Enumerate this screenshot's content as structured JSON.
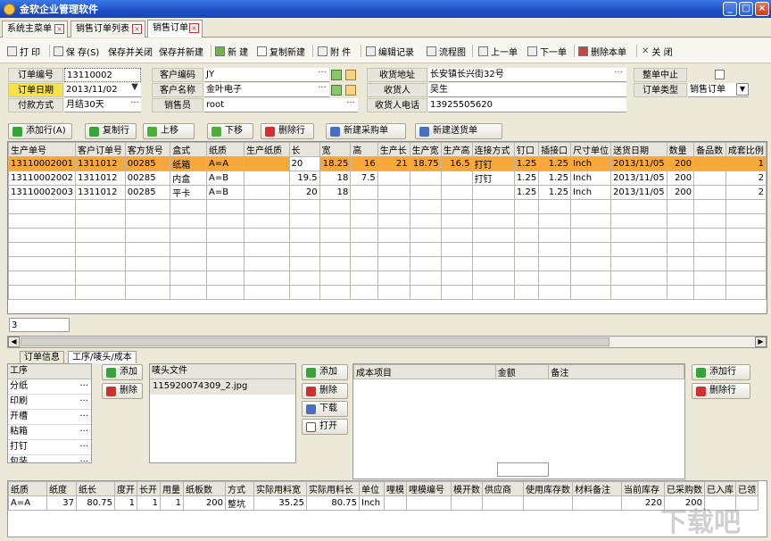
{
  "app": {
    "title": "金软企业管理软件",
    "icon": "app-icon"
  },
  "tabs": [
    {
      "label": "系统主菜单"
    },
    {
      "label": "销售订单列表"
    },
    {
      "label": "销售订单"
    }
  ],
  "toolbar": {
    "print": "打 印",
    "save": "保 存(S)",
    "save_close": "保存并关闭",
    "save_new": "保存并新建",
    "new": "新 建",
    "copy_new": "复制新建",
    "attach": "附 件",
    "edit_log": "编辑记录",
    "flowchart": "流程图",
    "prev": "上一单",
    "next": "下一单",
    "delete": "删除本单",
    "close": "关 闭"
  },
  "form": {
    "order_no_label": "订单编号",
    "order_no": "13110002",
    "order_date_label": "订单日期",
    "order_date": "2013/11/02",
    "pay_label": "付款方式",
    "pay": "月结30天",
    "cust_code_label": "客户编码",
    "cust_code": "JY",
    "cust_name_label": "客户名称",
    "cust_name": "金叶电子",
    "sales_label": "销售员",
    "sales": "root",
    "addr_label": "收货地址",
    "addr": "长安镇长兴街32号",
    "receiver_label": "收货人",
    "receiver": "吴生",
    "phone_label": "收货人电话",
    "phone": "13925505620",
    "suspend_label": "整单中止",
    "type_label": "订单类型",
    "type": "销售订单"
  },
  "actions": {
    "add_row": "添加行(A)",
    "copy_row": "复制行",
    "up": "上移",
    "down": "下移",
    "del_row": "删除行",
    "new_purchase": "新建采购单",
    "new_delivery": "新建送货单"
  },
  "grid": {
    "columns": [
      "生产单号",
      "客户订单号",
      "客方货号",
      "盒式",
      "纸质",
      "生产纸质",
      "长",
      "宽",
      "高",
      "生产长",
      "生产宽",
      "生产高",
      "连接方式",
      "钉口",
      "插接口",
      "尺寸单位",
      "送货日期",
      "数量",
      "备品数",
      "成套比例"
    ],
    "rows": [
      [
        "13110002001",
        "1311012",
        "00285",
        "纸箱",
        "A=A",
        "",
        "20",
        "18.25",
        "16",
        "21",
        "18.75",
        "16.5",
        "打钉",
        "1.25",
        "1.25",
        "Inch",
        "2013/11/05",
        "200",
        "",
        "1"
      ],
      [
        "13110002002",
        "1311012",
        "00285",
        "内盒",
        "A=B",
        "",
        "19.5",
        "18",
        "7.5",
        "",
        "",
        "",
        "打钉",
        "1.25",
        "1.25",
        "Inch",
        "2013/11/05",
        "200",
        "",
        "2"
      ],
      [
        "13110002003",
        "1311012",
        "00285",
        "平卡",
        "A=B",
        "",
        "20",
        "18",
        "",
        "",
        "",
        "",
        "",
        "1.25",
        "1.25",
        "Inch",
        "2013/11/05",
        "200",
        "",
        "2"
      ]
    ]
  },
  "row_count": "3",
  "lower_tabs": [
    "订单信息",
    "工序/唛头/成本"
  ],
  "process": {
    "header": "工序",
    "items": [
      "分纸",
      "印刷",
      "开槽",
      "粘箱",
      "打钉",
      "包装"
    ],
    "add": "添加",
    "del": "删除"
  },
  "mark": {
    "header": "唛头文件",
    "file": "115920074309_2.jpg",
    "add": "添加",
    "del": "删除",
    "download": "下载",
    "open": "打开"
  },
  "cost": {
    "columns": [
      "成本项目",
      "金额",
      "备注"
    ],
    "add_row": "添加行",
    "del_row": "删除行"
  },
  "material": {
    "columns": [
      "纸质",
      "纸度",
      "纸长",
      "度开",
      "长开",
      "用量",
      "纸板数",
      "方式",
      "实际用料宽",
      "实际用料长",
      "单位",
      "哩模",
      "哩模编号",
      "模开数",
      "供应商",
      "使用库存数",
      "材料备注",
      "当前库存",
      "已采购数",
      "已入库",
      "已领"
    ],
    "row": [
      "A=A",
      "37",
      "80.75",
      "1",
      "1",
      "1",
      "200",
      "整坑",
      "35.25",
      "80.75",
      "Inch",
      "",
      "",
      "",
      "",
      "",
      "",
      "220",
      "200",
      "",
      ""
    ]
  },
  "watermark": "下载吧"
}
